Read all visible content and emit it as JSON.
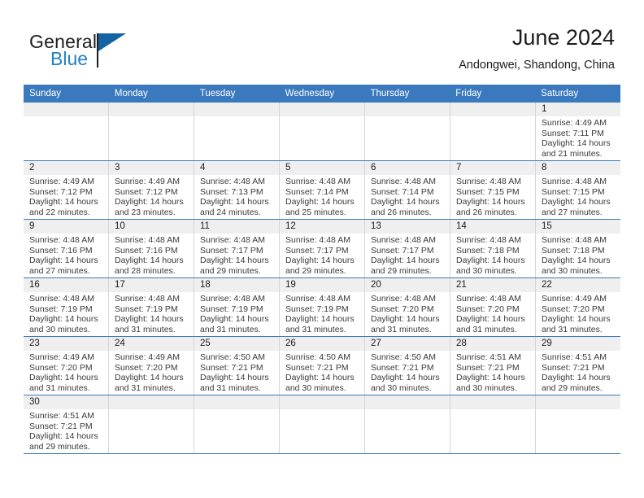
{
  "brand": {
    "word1": "General",
    "word2": "Blue",
    "flag_icon": "blue-flag-icon"
  },
  "header": {
    "month_title": "June 2024",
    "location": "Andongwei, Shandong, China"
  },
  "colors": {
    "header_bar": "#3a79bd",
    "day_number_bg": "#efefef",
    "brand_blue": "#2280c6",
    "cell_border": "#d5d5d5",
    "text": "#1b1b1b"
  },
  "calendar": {
    "weekdays": [
      "Sunday",
      "Monday",
      "Tuesday",
      "Wednesday",
      "Thursday",
      "Friday",
      "Saturday"
    ],
    "labels": {
      "sunrise": "Sunrise:",
      "sunset": "Sunset:",
      "daylight": "Daylight:"
    },
    "weeks": [
      [
        {
          "day": "",
          "empty": true
        },
        {
          "day": "",
          "empty": true
        },
        {
          "day": "",
          "empty": true
        },
        {
          "day": "",
          "empty": true
        },
        {
          "day": "",
          "empty": true
        },
        {
          "day": "",
          "empty": true
        },
        {
          "day": "1",
          "sunrise": "Sunrise: 4:49 AM",
          "sunset": "Sunset: 7:11 PM",
          "daylight": "Daylight: 14 hours and 21 minutes."
        }
      ],
      [
        {
          "day": "2",
          "sunrise": "Sunrise: 4:49 AM",
          "sunset": "Sunset: 7:12 PM",
          "daylight": "Daylight: 14 hours and 22 minutes."
        },
        {
          "day": "3",
          "sunrise": "Sunrise: 4:49 AM",
          "sunset": "Sunset: 7:12 PM",
          "daylight": "Daylight: 14 hours and 23 minutes."
        },
        {
          "day": "4",
          "sunrise": "Sunrise: 4:48 AM",
          "sunset": "Sunset: 7:13 PM",
          "daylight": "Daylight: 14 hours and 24 minutes."
        },
        {
          "day": "5",
          "sunrise": "Sunrise: 4:48 AM",
          "sunset": "Sunset: 7:14 PM",
          "daylight": "Daylight: 14 hours and 25 minutes."
        },
        {
          "day": "6",
          "sunrise": "Sunrise: 4:48 AM",
          "sunset": "Sunset: 7:14 PM",
          "daylight": "Daylight: 14 hours and 26 minutes."
        },
        {
          "day": "7",
          "sunrise": "Sunrise: 4:48 AM",
          "sunset": "Sunset: 7:15 PM",
          "daylight": "Daylight: 14 hours and 26 minutes."
        },
        {
          "day": "8",
          "sunrise": "Sunrise: 4:48 AM",
          "sunset": "Sunset: 7:15 PM",
          "daylight": "Daylight: 14 hours and 27 minutes."
        }
      ],
      [
        {
          "day": "9",
          "sunrise": "Sunrise: 4:48 AM",
          "sunset": "Sunset: 7:16 PM",
          "daylight": "Daylight: 14 hours and 27 minutes."
        },
        {
          "day": "10",
          "sunrise": "Sunrise: 4:48 AM",
          "sunset": "Sunset: 7:16 PM",
          "daylight": "Daylight: 14 hours and 28 minutes."
        },
        {
          "day": "11",
          "sunrise": "Sunrise: 4:48 AM",
          "sunset": "Sunset: 7:17 PM",
          "daylight": "Daylight: 14 hours and 29 minutes."
        },
        {
          "day": "12",
          "sunrise": "Sunrise: 4:48 AM",
          "sunset": "Sunset: 7:17 PM",
          "daylight": "Daylight: 14 hours and 29 minutes."
        },
        {
          "day": "13",
          "sunrise": "Sunrise: 4:48 AM",
          "sunset": "Sunset: 7:17 PM",
          "daylight": "Daylight: 14 hours and 29 minutes."
        },
        {
          "day": "14",
          "sunrise": "Sunrise: 4:48 AM",
          "sunset": "Sunset: 7:18 PM",
          "daylight": "Daylight: 14 hours and 30 minutes."
        },
        {
          "day": "15",
          "sunrise": "Sunrise: 4:48 AM",
          "sunset": "Sunset: 7:18 PM",
          "daylight": "Daylight: 14 hours and 30 minutes."
        }
      ],
      [
        {
          "day": "16",
          "sunrise": "Sunrise: 4:48 AM",
          "sunset": "Sunset: 7:19 PM",
          "daylight": "Daylight: 14 hours and 30 minutes."
        },
        {
          "day": "17",
          "sunrise": "Sunrise: 4:48 AM",
          "sunset": "Sunset: 7:19 PM",
          "daylight": "Daylight: 14 hours and 31 minutes."
        },
        {
          "day": "18",
          "sunrise": "Sunrise: 4:48 AM",
          "sunset": "Sunset: 7:19 PM",
          "daylight": "Daylight: 14 hours and 31 minutes."
        },
        {
          "day": "19",
          "sunrise": "Sunrise: 4:48 AM",
          "sunset": "Sunset: 7:19 PM",
          "daylight": "Daylight: 14 hours and 31 minutes."
        },
        {
          "day": "20",
          "sunrise": "Sunrise: 4:48 AM",
          "sunset": "Sunset: 7:20 PM",
          "daylight": "Daylight: 14 hours and 31 minutes."
        },
        {
          "day": "21",
          "sunrise": "Sunrise: 4:48 AM",
          "sunset": "Sunset: 7:20 PM",
          "daylight": "Daylight: 14 hours and 31 minutes."
        },
        {
          "day": "22",
          "sunrise": "Sunrise: 4:49 AM",
          "sunset": "Sunset: 7:20 PM",
          "daylight": "Daylight: 14 hours and 31 minutes."
        }
      ],
      [
        {
          "day": "23",
          "sunrise": "Sunrise: 4:49 AM",
          "sunset": "Sunset: 7:20 PM",
          "daylight": "Daylight: 14 hours and 31 minutes."
        },
        {
          "day": "24",
          "sunrise": "Sunrise: 4:49 AM",
          "sunset": "Sunset: 7:20 PM",
          "daylight": "Daylight: 14 hours and 31 minutes."
        },
        {
          "day": "25",
          "sunrise": "Sunrise: 4:50 AM",
          "sunset": "Sunset: 7:21 PM",
          "daylight": "Daylight: 14 hours and 31 minutes."
        },
        {
          "day": "26",
          "sunrise": "Sunrise: 4:50 AM",
          "sunset": "Sunset: 7:21 PM",
          "daylight": "Daylight: 14 hours and 30 minutes."
        },
        {
          "day": "27",
          "sunrise": "Sunrise: 4:50 AM",
          "sunset": "Sunset: 7:21 PM",
          "daylight": "Daylight: 14 hours and 30 minutes."
        },
        {
          "day": "28",
          "sunrise": "Sunrise: 4:51 AM",
          "sunset": "Sunset: 7:21 PM",
          "daylight": "Daylight: 14 hours and 30 minutes."
        },
        {
          "day": "29",
          "sunrise": "Sunrise: 4:51 AM",
          "sunset": "Sunset: 7:21 PM",
          "daylight": "Daylight: 14 hours and 29 minutes."
        }
      ],
      [
        {
          "day": "30",
          "sunrise": "Sunrise: 4:51 AM",
          "sunset": "Sunset: 7:21 PM",
          "daylight": "Daylight: 14 hours and 29 minutes."
        },
        {
          "day": "",
          "empty": true
        },
        {
          "day": "",
          "empty": true
        },
        {
          "day": "",
          "empty": true
        },
        {
          "day": "",
          "empty": true
        },
        {
          "day": "",
          "empty": true
        },
        {
          "day": "",
          "empty": true
        }
      ]
    ]
  }
}
